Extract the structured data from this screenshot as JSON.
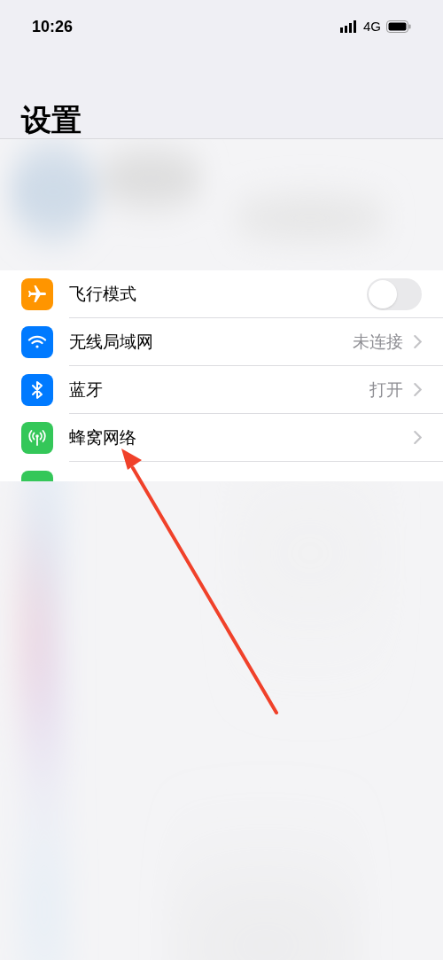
{
  "status_bar": {
    "time": "10:26",
    "network": "4G"
  },
  "title": "设置",
  "rows": [
    {
      "kind": "toggle",
      "label": "飞行模式",
      "on": false
    },
    {
      "kind": "link",
      "label": "无线局域网",
      "value": "未连接"
    },
    {
      "kind": "link",
      "label": "蓝牙",
      "value": "打开"
    },
    {
      "kind": "link",
      "label": "蜂窝网络"
    }
  ]
}
